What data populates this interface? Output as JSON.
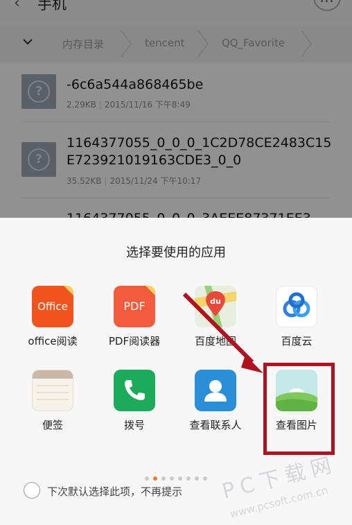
{
  "header": {
    "title": "手机",
    "back_icon": "chevron-left-icon",
    "more_icon": "more-dots-icon"
  },
  "breadcrumb": {
    "toggle_icon": "chevron-down-icon",
    "items": [
      "内存目录",
      "tencent",
      "QQ_Favorite"
    ]
  },
  "files": [
    {
      "name": "-6c6a544a868465be",
      "size": "2.29KB",
      "date": "2015/11/16 下午8:49",
      "icon": "unknown-file-icon"
    },
    {
      "name": "1164377055_0_0_0_1C2D78CE2483C15E723921019163CDE3_0_0",
      "size": "35.52KB",
      "date": "2015/11/24 下午10:17",
      "icon": "unknown-file-icon"
    },
    {
      "name": "1164377055_0_0_0_3AEEE87371EE3",
      "size": "",
      "date": "",
      "icon": "unknown-file-icon"
    }
  ],
  "chooser": {
    "title": "选择要使用的应用",
    "apps": [
      {
        "label": "office阅读",
        "icon_text": "Office",
        "icon": "office-icon"
      },
      {
        "label": "PDF阅读器",
        "icon_text": "PDF",
        "icon": "pdf-icon"
      },
      {
        "label": "百度地图",
        "icon_text": "du",
        "icon": "baidu-map-icon"
      },
      {
        "label": "百度云",
        "icon_text": "",
        "icon": "baidu-cloud-icon"
      },
      {
        "label": "便签",
        "icon_text": "",
        "icon": "notes-icon"
      },
      {
        "label": "拨号",
        "icon_text": "",
        "icon": "phone-icon"
      },
      {
        "label": "查看联系人",
        "icon_text": "",
        "icon": "contacts-icon"
      },
      {
        "label": "查看图片",
        "icon_text": "",
        "icon": "gallery-icon"
      }
    ],
    "page_count": 8,
    "active_page": 2,
    "remember_choice": {
      "label": "下次默认选择此项，不再提示",
      "checked": false
    }
  },
  "watermark": {
    "main": "PC下载网",
    "url": "www.pcsoft.com.cn"
  },
  "colors": {
    "accent_dot": "#f37a1f",
    "highlight_box": "#b01220",
    "arrow": "#b01220"
  }
}
